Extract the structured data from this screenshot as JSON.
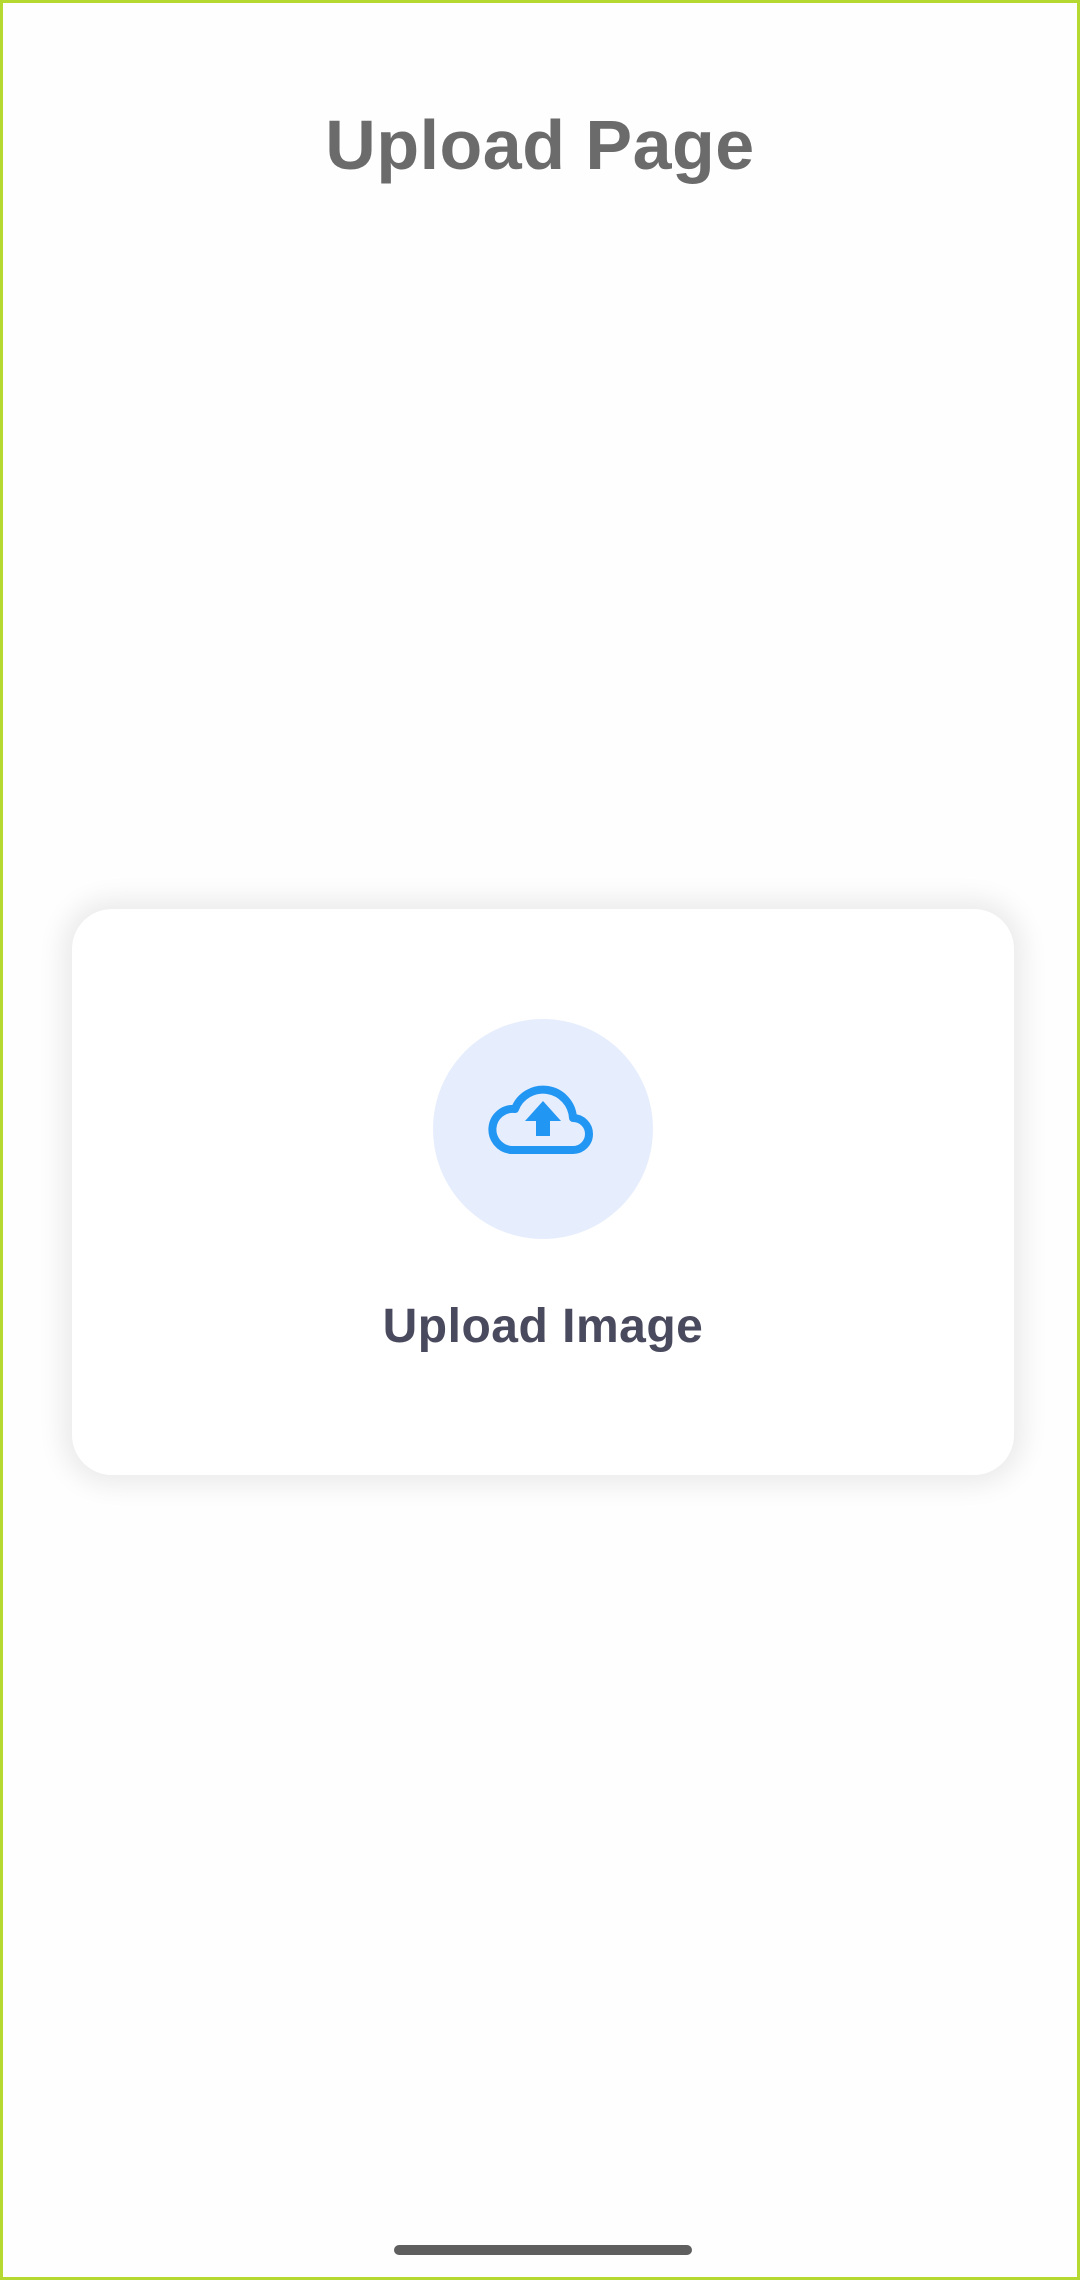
{
  "header": {
    "title": "Upload Page"
  },
  "upload_card": {
    "label": "Upload Image",
    "icon": "cloud-upload-icon"
  },
  "colors": {
    "frame_border": "#b5d930",
    "title_text": "#6b6b6b",
    "label_text": "#4a4a5e",
    "icon_accent": "#2196f3",
    "icon_background": "#e6edfd",
    "card_background": "#ffffff"
  }
}
